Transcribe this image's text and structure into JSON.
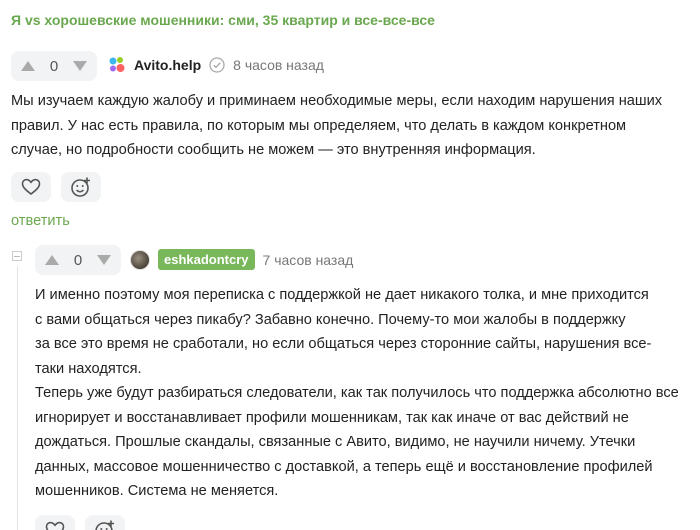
{
  "post": {
    "title": "Я vs хорошевские мошенники: сми, 35 квартир и все-все-все"
  },
  "comment1": {
    "rating": "0",
    "author": "Avito.help",
    "time": "8 часов назад",
    "lines": [
      "Мы изучаем каждую жалобу и приминаем необходимые меры, если находим нарушения наших",
      "правил. У нас есть правила, по которым мы определяем, что делать в каждом конкретном",
      "случае, но подробности сообщить не можем — это внутренняя информация."
    ],
    "reply_label": "ответить"
  },
  "comment2": {
    "rating": "0",
    "author": "eshkadontcry",
    "time": "7 часов назад",
    "lines": [
      "И именно поэтому моя переписка с поддержкой не дает никакого толка, и мне приходится",
      "с вами общаться через пикабу? Забавно конечно. Почему-то мои жалобы в поддержку",
      "за все это время не сработали, но если общаться через сторонние сайты, нарушения все-",
      "таки находятся.",
      "Теперь уже будут разбираться следователи, как так получилось что поддержка абсолютно все",
      "игнорирует и восстанавливает профили мошенникам, так как иначе от вас действий не",
      "дождаться. Прошлые скандалы, связанные с Авито, видимо, не научили ничему. Утечки",
      "данных, массовое мошенничество с доставкой, а теперь ещё и восстановление профилей",
      "мошенников. Система не меняется."
    ]
  },
  "colors": {
    "accent": "#6aa84f",
    "badge": "#79b85a",
    "button_bg": "#f2f3f4"
  }
}
